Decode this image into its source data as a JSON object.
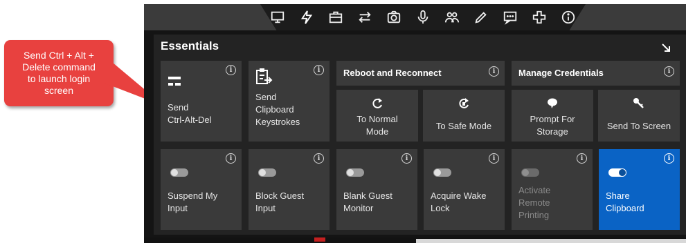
{
  "callout": {
    "text": "Send Ctrl + Alt +\nDelete command\nto launch login\nscreen"
  },
  "toolbar": {
    "icons": [
      "monitor-icon",
      "lightning-icon",
      "briefcase-icon",
      "transfer-arrows-icon",
      "camera-icon",
      "microphone-icon",
      "users-icon",
      "pencil-icon",
      "chat-icon",
      "plus-icon",
      "info-icon"
    ],
    "active": "lightning-icon"
  },
  "panel": {
    "title": "Essentials",
    "info_glyph": "i",
    "tiles": {
      "send_cad": {
        "label": "Send\nCtrl-Alt-Del"
      },
      "send_clipboard": {
        "label": "Send\nClipboard\nKeystrokes"
      },
      "reboot": {
        "title": "Reboot and Reconnect",
        "normal": "To Normal\nMode",
        "safe": "To Safe Mode"
      },
      "credentials": {
        "title": "Manage Credentials",
        "prompt": "Prompt For\nStorage",
        "send_screen": "Send To Screen"
      },
      "suspend": {
        "label": "Suspend My\nInput",
        "on": false
      },
      "block_guest": {
        "label": "Block Guest\nInput",
        "on": false
      },
      "blank_monitor": {
        "label": "Blank Guest\nMonitor",
        "on": false
      },
      "wake_lock": {
        "label": "Acquire Wake\nLock",
        "on": false
      },
      "remote_printing": {
        "label": "Activate\nRemote\nPrinting",
        "on": false,
        "disabled": true
      },
      "share_clipboard": {
        "label": "Share\nClipboard",
        "on": true
      }
    }
  },
  "colors": {
    "accent": "#0a63c5",
    "callout": "#e8413f",
    "tile": "#3a3a3a"
  }
}
